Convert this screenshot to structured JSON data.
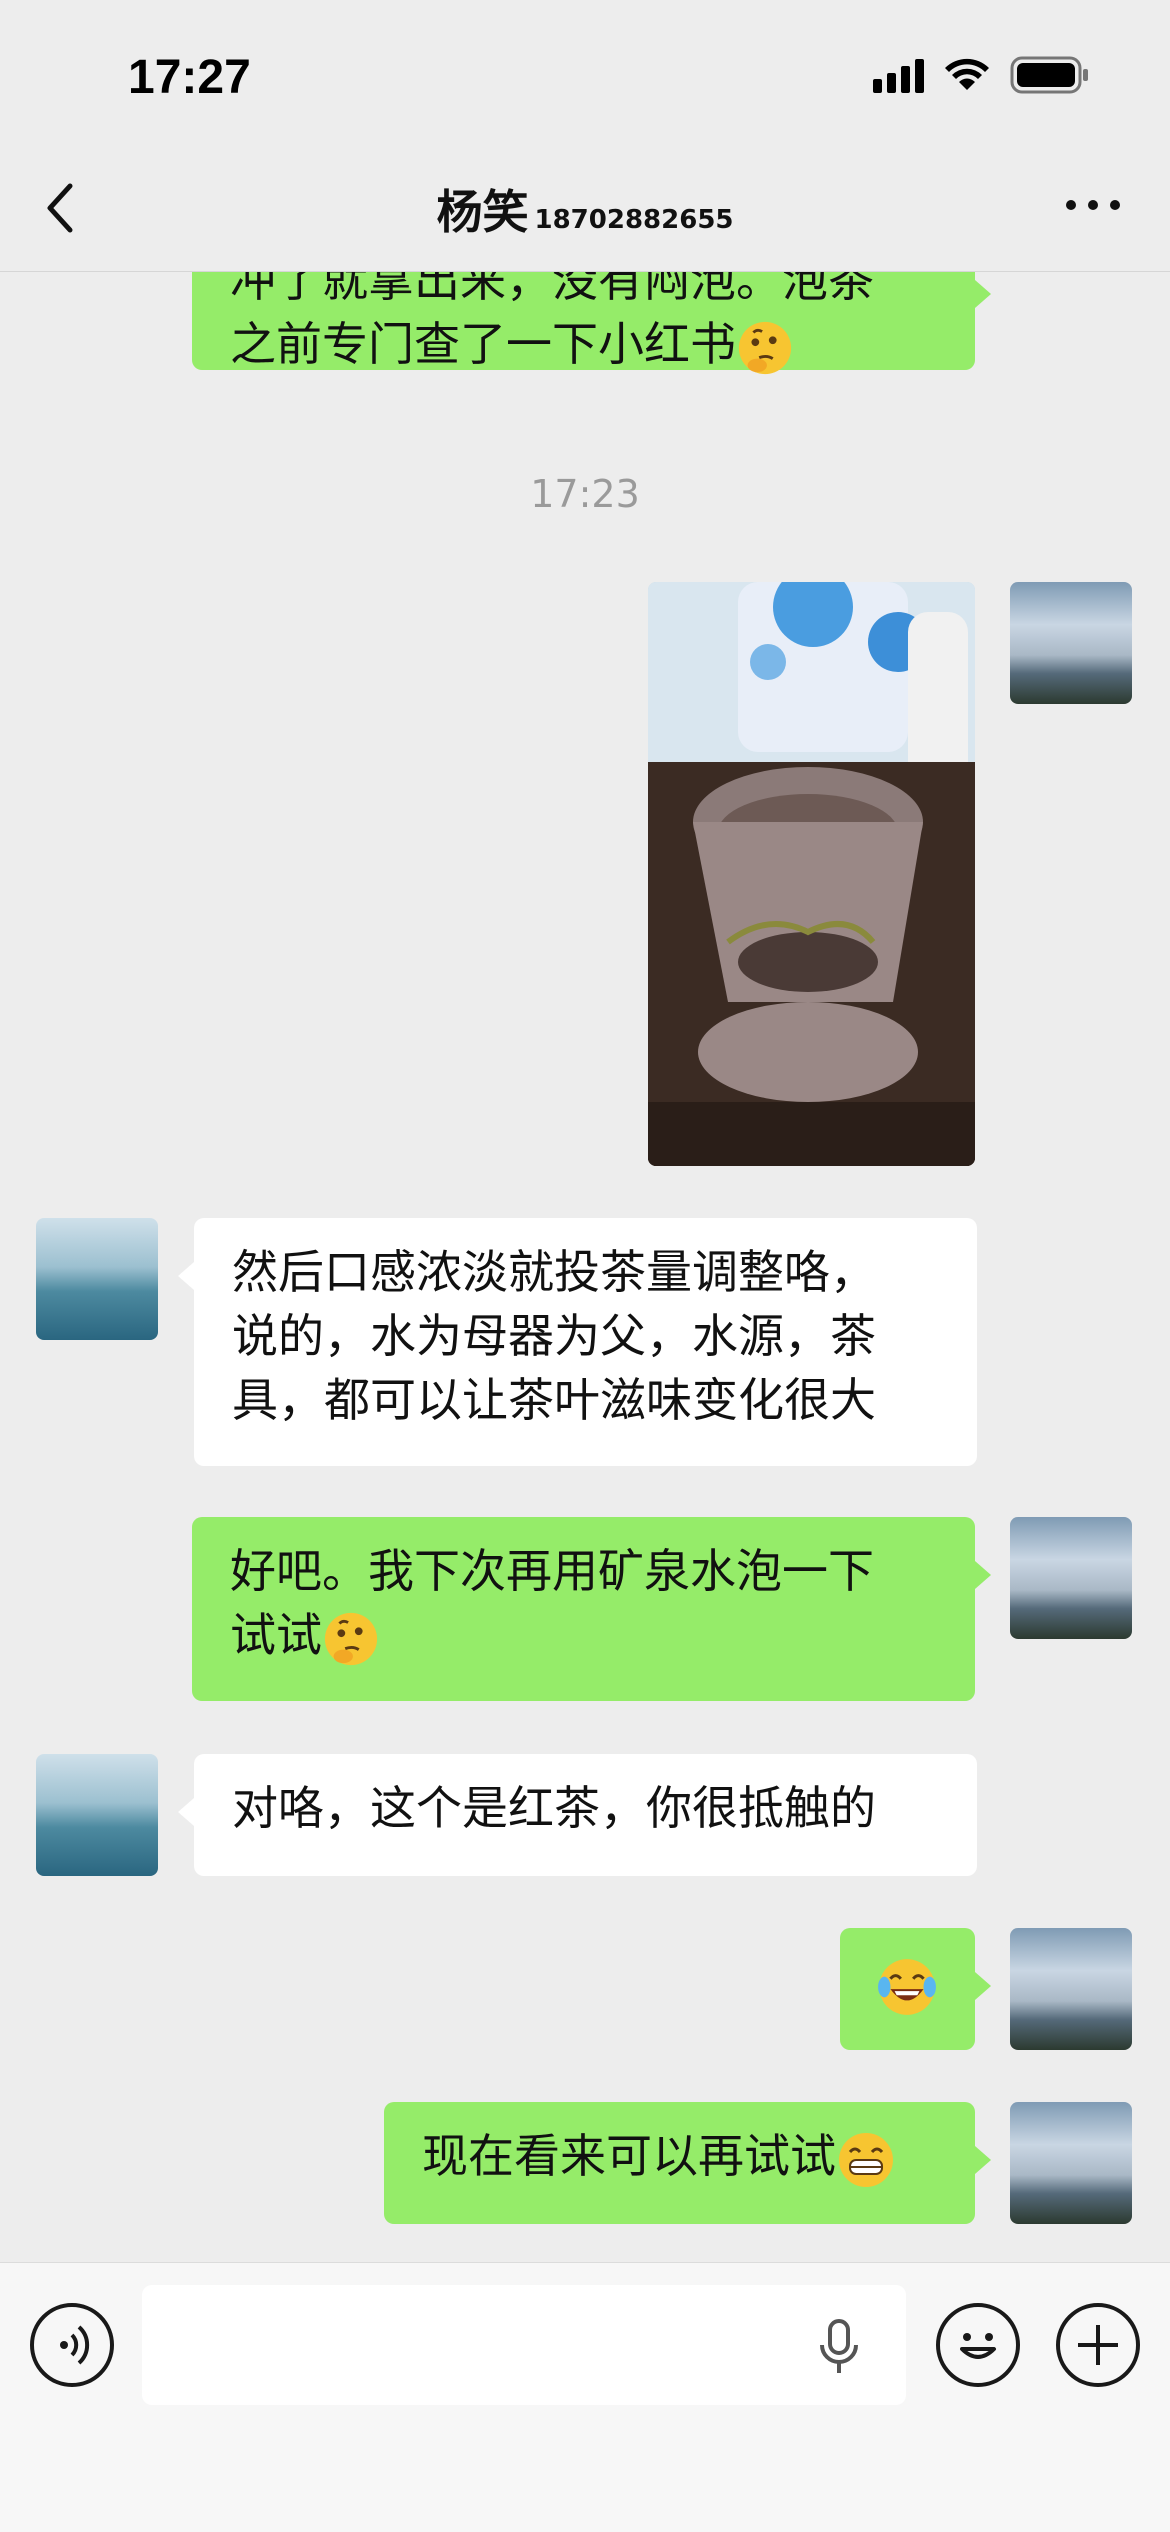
{
  "status": {
    "time": "17:27"
  },
  "header": {
    "contact_name": "杨笑",
    "contact_phone": "18702882655"
  },
  "messages": [
    {
      "from": "me",
      "type": "text",
      "lines": [
        "冲了就拿出来，没有闷泡。泡茶",
        "之前专门查了一下小红书"
      ],
      "emoji": "thinking"
    },
    {
      "type": "timestamp",
      "text": "17:23"
    },
    {
      "from": "me",
      "type": "image",
      "description": "tea infuser cup"
    },
    {
      "from": "them",
      "type": "text",
      "lines": [
        "然后口感浓淡就投茶量调整咯，",
        "说的，水为母器为父，水源，茶",
        "具，都可以让茶叶滋味变化很大"
      ]
    },
    {
      "from": "me",
      "type": "text",
      "lines": [
        "好吧。我下次再用矿泉水泡一下",
        "试试"
      ],
      "emoji": "thinking"
    },
    {
      "from": "them",
      "type": "text",
      "lines": [
        "对咯，这个是红茶，你很抵触的"
      ]
    },
    {
      "from": "me",
      "type": "emoji",
      "emoji": "laughing-tears"
    },
    {
      "from": "me",
      "type": "text",
      "lines": [
        "现在看来可以再试试"
      ],
      "emoji": "grinning"
    }
  ],
  "input": {
    "placeholder": ""
  },
  "colors": {
    "bubble_me": "#95ec69",
    "bubble_them": "#ffffff",
    "background": "#ededed"
  }
}
